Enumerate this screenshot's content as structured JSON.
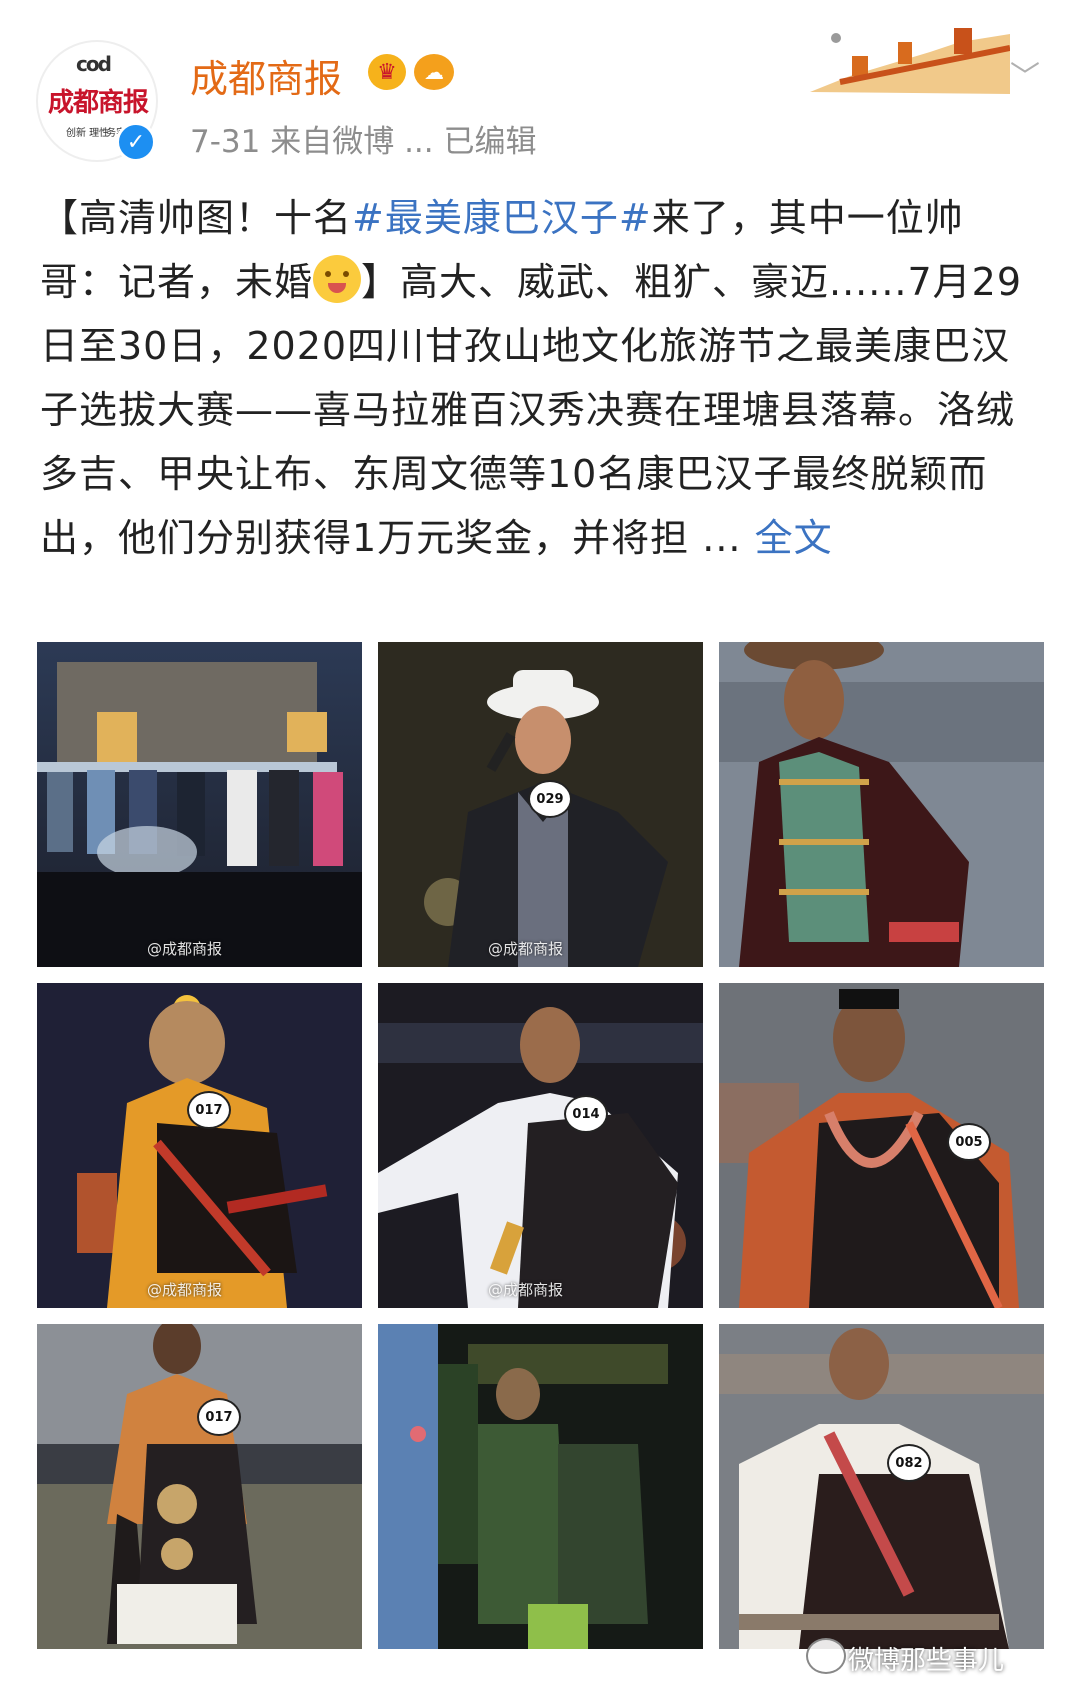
{
  "header": {
    "avatar_logo": "成都商报",
    "avatar_mark": "cod",
    "avatar_sub1": "创新 理性",
    "avatar_sub2": "务实 开放",
    "username": "成都商报",
    "meta": "7-31  来自微博 ...  已编辑"
  },
  "post": {
    "text_1": "【高清帅图！十名",
    "hashtag": "#最美康巴汉子#",
    "text_2": "来了，其中一位帅哥：记者，未婚",
    "text_3": "】高大、威武、粗犷、豪迈......7月29日至30日，2020四川甘孜山地文化旅游节之最美康巴汉子选拔大赛——喜马拉雅百汉秀决赛在理塘县落幕。洛绒多吉、甲央让布、东周文德等10名康巴汉子最终脱颖而出，他们分别获得1万元奖金，并将担 ...",
    "more_link": "全文"
  },
  "photos": {
    "watermark_1": "@成都商报",
    "watermark_2": "@成都商报",
    "badge_2": "029",
    "badge_4": "017",
    "watermark_4": "@成都商报",
    "badge_5": "014",
    "watermark_5": "@成都商报",
    "badge_6": "005",
    "badge_7": "017",
    "badge_9": "082"
  },
  "footer": {
    "watermark": "微博那些事儿"
  },
  "colors": {
    "username": "#e36a16",
    "link": "#3b73c2",
    "meta": "#8d8d8d",
    "verified": "#1d8ff2"
  }
}
